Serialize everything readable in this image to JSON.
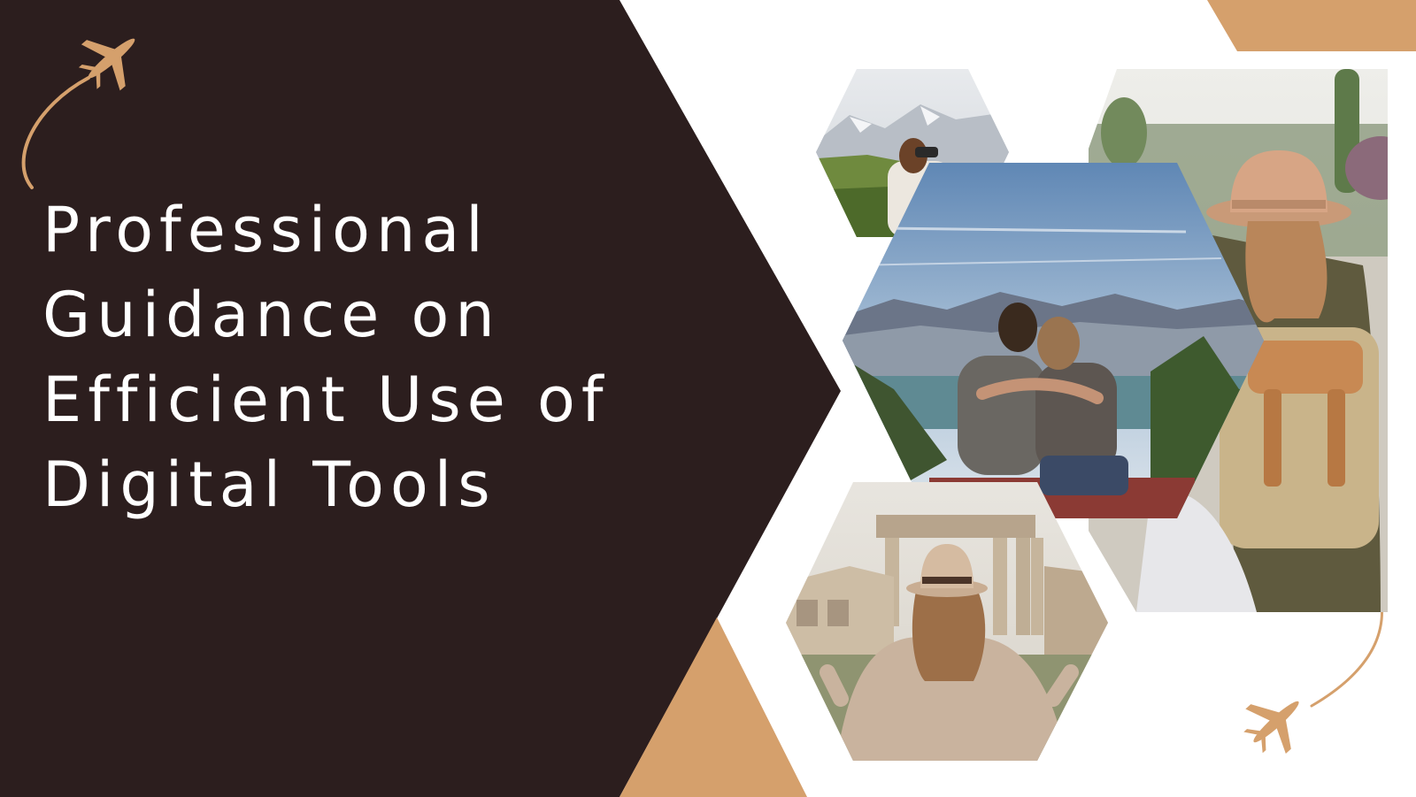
{
  "title_lines": [
    "Professional",
    "Guidance on",
    "Efficient Use of",
    "Digital Tools"
  ],
  "colors": {
    "panel": "#2c1e1e",
    "accent": "#d5a06c",
    "background": "#ffffff"
  },
  "icons": [
    "airplane-icon",
    "airplane-icon"
  ],
  "photos": [
    "mountain-hiker-with-binoculars-photo",
    "couple-at-mountain-lake-photo",
    "traveler-with-hat-and-backpack-photo",
    "traveler-at-roman-ruins-photo"
  ]
}
